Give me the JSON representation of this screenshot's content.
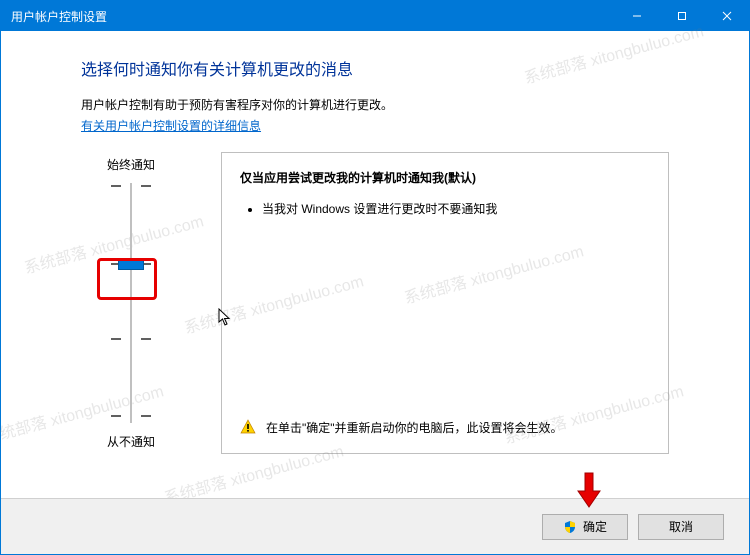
{
  "titlebar": {
    "title": "用户帐户控制设置"
  },
  "heading": "选择何时通知你有关计算机更改的消息",
  "description": "用户帐户控制有助于预防有害程序对你的计算机进行更改。",
  "link_text": "有关用户帐户控制设置的详细信息",
  "slider": {
    "top_label": "始终通知",
    "bottom_label": "从不通知",
    "levels": 4,
    "current_level": 1
  },
  "info": {
    "title": "仅当应用尝试更改我的计算机时通知我(默认)",
    "bullets": [
      "当我对 Windows 设置进行更改时不要通知我"
    ],
    "warning": "在单击\"确定\"并重新启动你的电脑后，此设置将会生效。"
  },
  "footer": {
    "ok_label": "确定",
    "cancel_label": "取消"
  },
  "watermark": "系统部落 xitongbuluo.com"
}
